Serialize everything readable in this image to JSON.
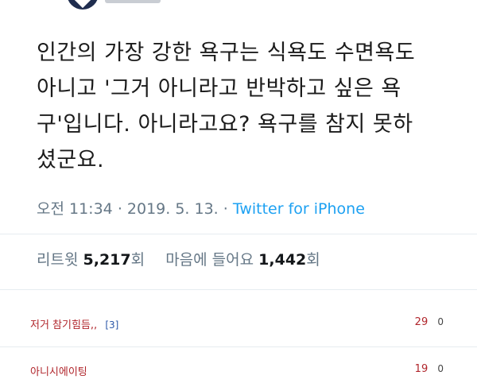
{
  "tweet": {
    "text_lines": [
      "인간의 가장 강한 욕구는 식욕도 수면욕도",
      "아니고 '그거 아니라고 반박하고 싶은 욕",
      "구'입니다. 아니라고요? 욕구를 참지 못하",
      "셨군요."
    ],
    "time": "오전 11:34",
    "date": "2019. 5. 13.",
    "source": "Twitter for iPhone",
    "retweets_label": "리트윗",
    "retweets_count": "5,217",
    "retweets_unit": "회",
    "likes_label": "마음에 들어요",
    "likes_count": "1,442",
    "likes_unit": "회"
  },
  "comments": [
    {
      "title": "저거 참기힘듬,,",
      "reply_count": "[3]",
      "recommend": "29",
      "dislike": "0"
    },
    {
      "title": "아니시에이팅",
      "reply_count": "",
      "recommend": "19",
      "dislike": "0"
    }
  ]
}
